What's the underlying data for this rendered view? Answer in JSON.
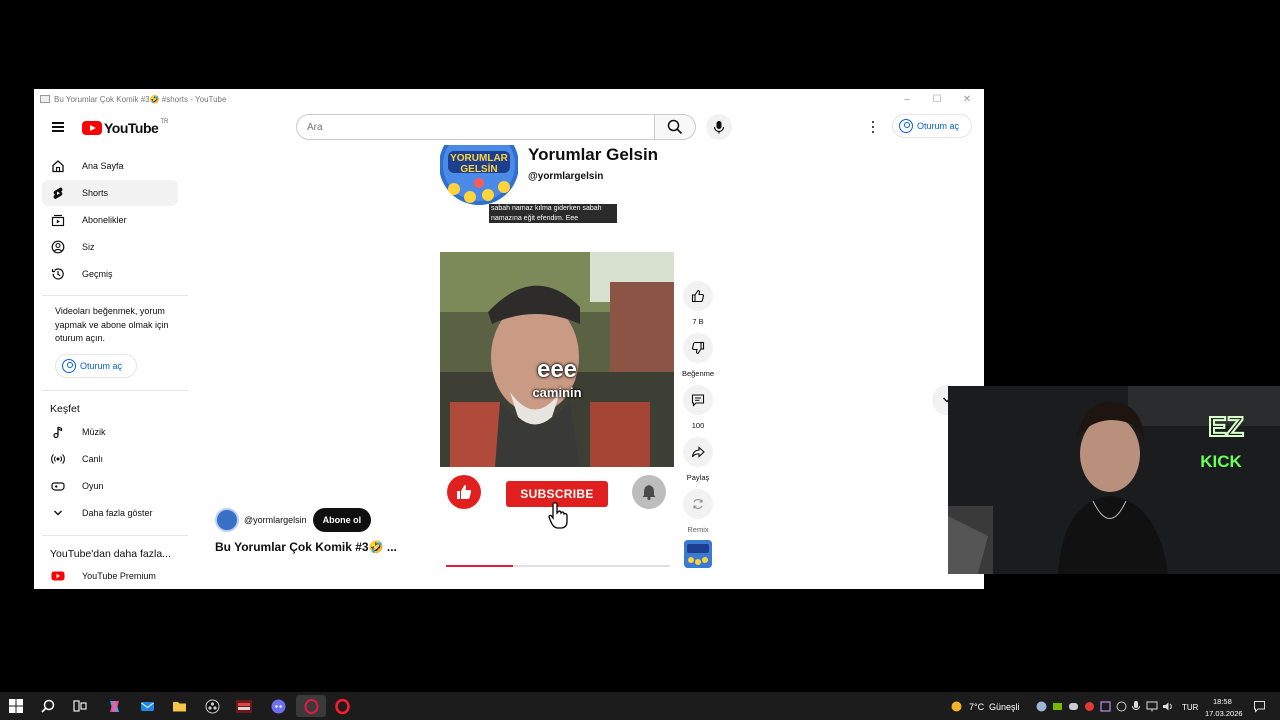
{
  "window": {
    "title": "Bu Yorumlar Çok Komik #3🤣 #shorts - YouTube",
    "controls": {
      "minimize": "–",
      "maximize": "☐",
      "close": "✕"
    }
  },
  "masthead": {
    "logo_text": "YouTube",
    "country_code": "TR",
    "search_placeholder": "Ara",
    "sign_in_label": "Oturum aç"
  },
  "sidebar": {
    "items": [
      {
        "label": "Ana Sayfa",
        "icon": "home-icon"
      },
      {
        "label": "Shorts",
        "icon": "shorts-icon",
        "active": true
      },
      {
        "label": "Abonelikler",
        "icon": "subscriptions-icon"
      },
      {
        "label": "Siz",
        "icon": "you-icon"
      },
      {
        "label": "Geçmiş",
        "icon": "history-icon"
      }
    ],
    "signin_note": "Videoları beğenmek, yorum yapmak ve abone olmak için oturum açın.",
    "signin_button": "Oturum aç",
    "explore_title": "Keşfet",
    "explore_items": [
      {
        "label": "Müzik",
        "icon": "music-icon"
      },
      {
        "label": "Canlı",
        "icon": "live-icon"
      },
      {
        "label": "Oyun",
        "icon": "gaming-icon"
      },
      {
        "label": "Daha fazla göster",
        "icon": "chevron-down-icon"
      }
    ],
    "more_title": "YouTube'dan daha fazla...",
    "more_items": [
      {
        "label": "YouTube Premium",
        "icon": "youtube-premium-icon"
      }
    ]
  },
  "short": {
    "channel_name": "Yorumlar Gelsin",
    "channel_handle": "@yormlargelsin",
    "avatar_text_line1": "YORUMLAR",
    "avatar_text_line2": "GELSİN",
    "caption": "sabah namaz kılma giderken sabah namazına eğit efendim. Eee",
    "overlay_big": "eee",
    "overlay_small": "caminin",
    "subscribe_graphic": "SUBSCRIBE",
    "progress": 0.3,
    "uploader_handle": "@yormlargelsin",
    "subscribe_button": "Abone ol",
    "title": "Bu Yorumlar Çok Komik #3🤣 ..."
  },
  "actions": {
    "like_count": "7 B",
    "dislike_label": "Beğenme",
    "comment_count": "100",
    "share_label": "Paylaş",
    "remix_label": "Remix"
  },
  "webcam": {
    "neon_sign_top": "EZ",
    "neon_sign_bottom": "KICK"
  },
  "taskbar": {
    "weather_temp": "7°C",
    "weather_text": "Güneşli",
    "language": "TUR",
    "time": "18:58",
    "date": "17.03.2026"
  },
  "colors": {
    "youtube_red": "#ff0000",
    "link_blue": "#065fd4",
    "subscribe_red": "#e0201e",
    "taskbar_bg": "#1c1c1c"
  }
}
